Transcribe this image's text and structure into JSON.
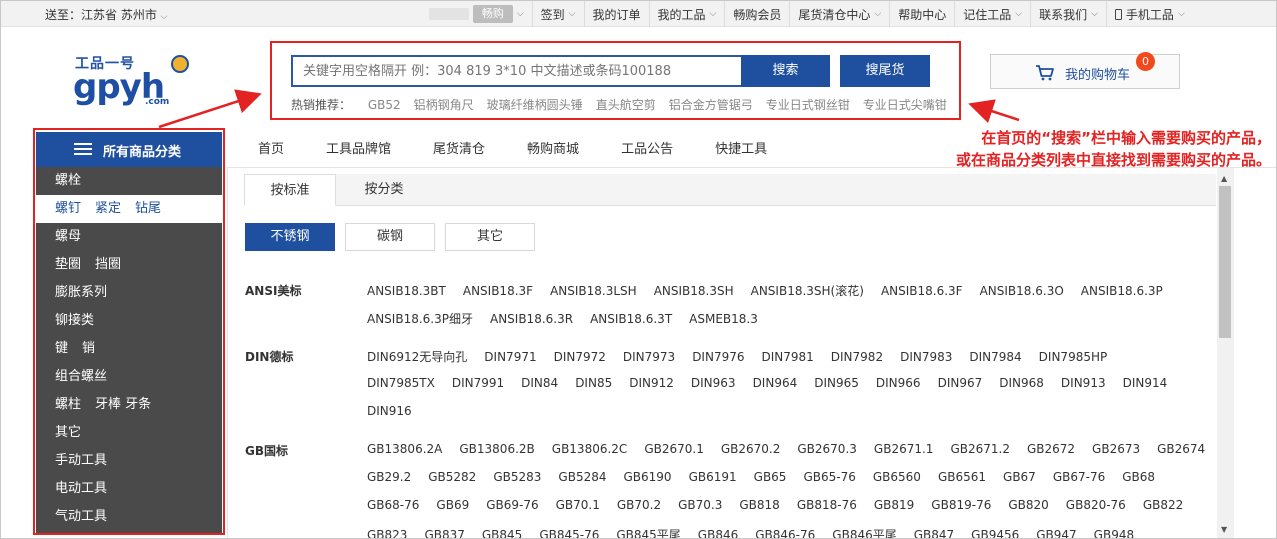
{
  "topbar": {
    "location_label": "送至：江苏省 苏州市",
    "blurred_pill": "畅购",
    "nav": [
      {
        "label": "签到",
        "chevron": true
      },
      {
        "label": "我的订单",
        "chevron": false
      },
      {
        "label": "我的工品",
        "chevron": true
      },
      {
        "label": "畅购会员",
        "chevron": false
      },
      {
        "label": "尾货清仓中心",
        "chevron": true
      },
      {
        "label": "帮助中心",
        "chevron": false
      },
      {
        "label": "记住工品",
        "chevron": true
      },
      {
        "label": "联系我们",
        "chevron": true
      },
      {
        "label": "手机工品",
        "chevron": true
      }
    ]
  },
  "logo": {
    "cn": "工品一号",
    "en": "gpyh",
    "domain": ".com"
  },
  "search": {
    "placeholder": "关键字用空格隔开 例：304 819 3*10 中文描述或条码100188",
    "search_label": "搜索",
    "tail_label": "搜尾货",
    "hot_label": "热销推荐：",
    "hot_items": [
      "GB52",
      "铝柄钢角尺",
      "玻璃纤维柄圆头锤",
      "直头航空剪",
      "铝合金方管锯弓",
      "专业日式钢丝钳",
      "专业日式尖嘴钳"
    ]
  },
  "cart": {
    "label": "我的购物车",
    "count": "0"
  },
  "annotation": {
    "line1": "在首页的“搜索”栏中输入需要购买的产品，",
    "line2": "或在商品分类列表中直接找到需要购买的产品。"
  },
  "sidebar": {
    "title": "所有商品分类",
    "items": [
      {
        "labels": [
          "螺栓"
        ],
        "active": false
      },
      {
        "labels": [
          "螺钉",
          "紧定",
          "钻尾"
        ],
        "active": true
      },
      {
        "labels": [
          "螺母"
        ],
        "active": false
      },
      {
        "labels": [
          "垫圈",
          "挡圈"
        ],
        "active": false
      },
      {
        "labels": [
          "膨胀系列"
        ],
        "active": false
      },
      {
        "labels": [
          "铆接类"
        ],
        "active": false
      },
      {
        "labels": [
          "键",
          "销"
        ],
        "active": false
      },
      {
        "labels": [
          "组合螺丝"
        ],
        "active": false
      },
      {
        "labels": [
          "螺柱",
          "牙棒 牙条"
        ],
        "active": false
      },
      {
        "labels": [
          "其它"
        ],
        "active": false
      },
      {
        "labels": [
          "手动工具"
        ],
        "active": false
      },
      {
        "labels": [
          "电动工具"
        ],
        "active": false
      },
      {
        "labels": [
          "气动工具"
        ],
        "active": false
      }
    ]
  },
  "mainnav": [
    "首页",
    "工具品牌馆",
    "尾货清仓",
    "畅购商城",
    "工品公告",
    "快捷工具"
  ],
  "tabs": [
    "按标准",
    "按分类"
  ],
  "materials": [
    {
      "label": "不锈钢",
      "active": true
    },
    {
      "label": "碳钢",
      "active": false
    },
    {
      "label": "其它",
      "active": false
    }
  ],
  "groups": [
    {
      "label": "ANSI美标",
      "rows": [
        [
          "ANSIB18.3BT",
          "ANSIB18.3F",
          "ANSIB18.3LSH",
          "ANSIB18.3SH",
          "ANSIB18.3SH(滚花)",
          "ANSIB18.6.3F",
          "ANSIB18.6.3O",
          "ANSIB18.6.3P"
        ],
        [
          "ANSIB18.6.3P细牙",
          "ANSIB18.6.3R",
          "ANSIB18.6.3T",
          "ASMEB18.3"
        ]
      ]
    },
    {
      "label": "DIN德标",
      "rows": [
        [
          "DIN6912无导向孔",
          "DIN7971",
          "DIN7972",
          "DIN7973",
          "DIN7976",
          "DIN7981",
          "DIN7982",
          "DIN7983",
          "DIN7984",
          "DIN7985HP"
        ],
        [
          "DIN7985TX",
          "DIN7991",
          "DIN84",
          "DIN85",
          "DIN912",
          "DIN963",
          "DIN964",
          "DIN965",
          "DIN966",
          "DIN967",
          "DIN968",
          "DIN913",
          "DIN914"
        ],
        [
          "DIN916"
        ]
      ]
    },
    {
      "label": "GB国标",
      "rows": [
        [
          "GB13806.2A",
          "GB13806.2B",
          "GB13806.2C",
          "GB2670.1",
          "GB2670.2",
          "GB2670.3",
          "GB2671.1",
          "GB2671.2",
          "GB2672",
          "GB2673",
          "GB2674"
        ],
        [
          "GB29.2",
          "GB5282",
          "GB5283",
          "GB5284",
          "GB6190",
          "GB6191",
          "GB65",
          "GB65-76",
          "GB6560",
          "GB6561",
          "GB67",
          "GB67-76",
          "GB68"
        ],
        [
          "GB68-76",
          "GB69",
          "GB69-76",
          "GB70.1",
          "GB70.2",
          "GB70.3",
          "GB818",
          "GB818-76",
          "GB819",
          "GB819-76",
          "GB820",
          "GB820-76",
          "GB822"
        ],
        [
          "GB823",
          "GB837",
          "GB845",
          "GB845-76",
          "GB845平尾",
          "GB846",
          "GB846-76",
          "GB846平尾",
          "GB847",
          "GB9456",
          "GB947",
          "GB948"
        ]
      ]
    }
  ],
  "colors": {
    "brand_blue": "#1f4f9f",
    "annotation_red": "#e32222",
    "sidebar_bg": "#4a4a4a",
    "badge": "#f2481c"
  }
}
